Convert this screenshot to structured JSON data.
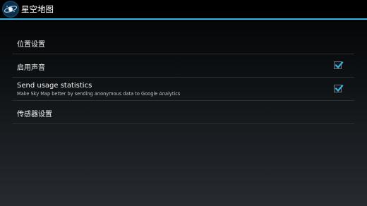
{
  "app": {
    "title": "星空地图",
    "icon": "sky-map-app-icon",
    "accent": "#33b5e5"
  },
  "preferences": [
    {
      "title": "位置设置",
      "summary": "",
      "type": "screen"
    },
    {
      "title": "启用声音",
      "summary": "",
      "type": "checkbox",
      "checked": true
    },
    {
      "title": "Send usage statistics",
      "summary": "Make Sky Map better by sending anonymous data to Google Analytics",
      "type": "checkbox",
      "checked": true
    },
    {
      "title": "传感器设置",
      "summary": "",
      "type": "screen"
    }
  ]
}
